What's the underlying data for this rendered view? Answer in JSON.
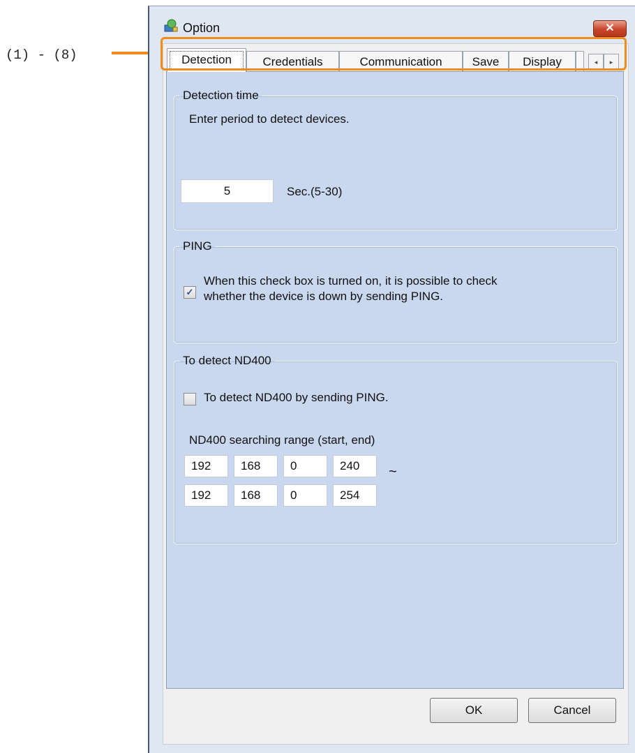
{
  "annotation": {
    "label": "(1) - (8)",
    "color": "#f08c1e"
  },
  "window": {
    "title": "Option",
    "close_symbol": "✕"
  },
  "tabs": [
    {
      "label": "Detection",
      "active": true
    },
    {
      "label": "Credentials",
      "active": false
    },
    {
      "label": "Communication",
      "active": false
    },
    {
      "label": "Save",
      "active": false
    },
    {
      "label": "Display",
      "active": false
    }
  ],
  "tab_scroll": {
    "left": "◂",
    "right": "▸"
  },
  "detection_time": {
    "legend": "Detection time",
    "description": "Enter period to detect devices.",
    "value": "5",
    "unit": "Sec.(5-30)"
  },
  "ping": {
    "legend": "PING",
    "checked": true,
    "check_mark": "✓",
    "line1": "When this check box is turned on, it is possible to check",
    "line2": "whether the device is down by sending PING."
  },
  "nd400": {
    "legend": "To detect ND400",
    "checked": false,
    "checkbox_label": "To detect ND400 by sending PING.",
    "range_label": "ND400 searching range (start, end)",
    "start": [
      "192",
      "168",
      "0",
      "240"
    ],
    "end": [
      "192",
      "168",
      "0",
      "254"
    ],
    "tilde": "~"
  },
  "buttons": {
    "ok": "OK",
    "cancel": "Cancel"
  },
  "colors": {
    "panel": "#c9d8ee",
    "client": "#f0f0f0",
    "close": "#c8452c"
  }
}
